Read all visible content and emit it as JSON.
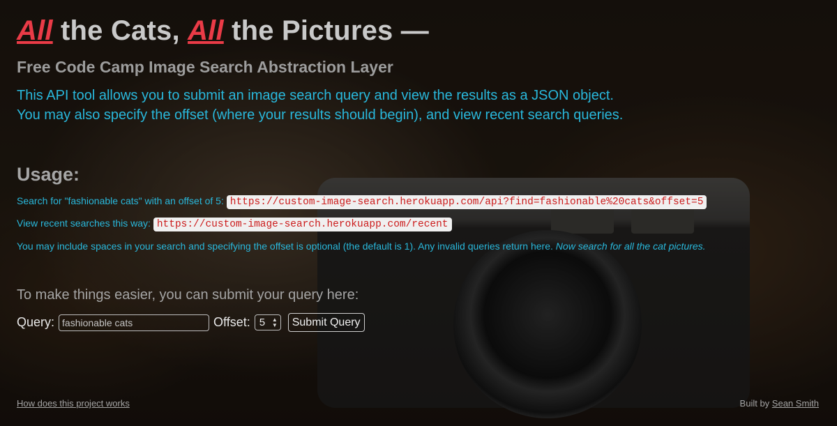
{
  "header": {
    "title_part1": "All",
    "title_part2": " the Cats, ",
    "title_part3": "All",
    "title_part4": " the Pictures —",
    "subtitle": "Free Code Camp Image Search Abstraction Layer",
    "intro_line1": "This API tool allows you to submit an image search query and view the results as a JSON object.",
    "intro_line2": "You may also specify the offset (where your results should begin), and view recent search queries."
  },
  "usage": {
    "heading": "Usage:",
    "search_text": "Search for \"fashionable cats\" with an offset of 5:",
    "search_url": "https://custom-image-search.herokuapp.com/api?find=fashionable%20cats&offset=5",
    "recent_text": "View recent searches this way:",
    "recent_url": "https://custom-image-search.herokuapp.com/recent",
    "note": "You may include spaces in your search and specifying the offset is optional (the default is 1). Any invalid queries return here.",
    "note_em": "Now search for all the cat pictures."
  },
  "form": {
    "prompt": "To make things easier, you can submit your query here:",
    "query_label": "Query:",
    "query_value": "fashionable cats",
    "offset_label": "Offset:",
    "offset_value": "5",
    "submit_label": "Submit Query"
  },
  "footer": {
    "how_link": "How does this project works",
    "built_by": "Built by ",
    "author": "Sean Smith"
  },
  "colors": {
    "accent_red": "#ea3b47",
    "intro_blue": "#29b8dc",
    "code_red": "#cc1b1b"
  }
}
